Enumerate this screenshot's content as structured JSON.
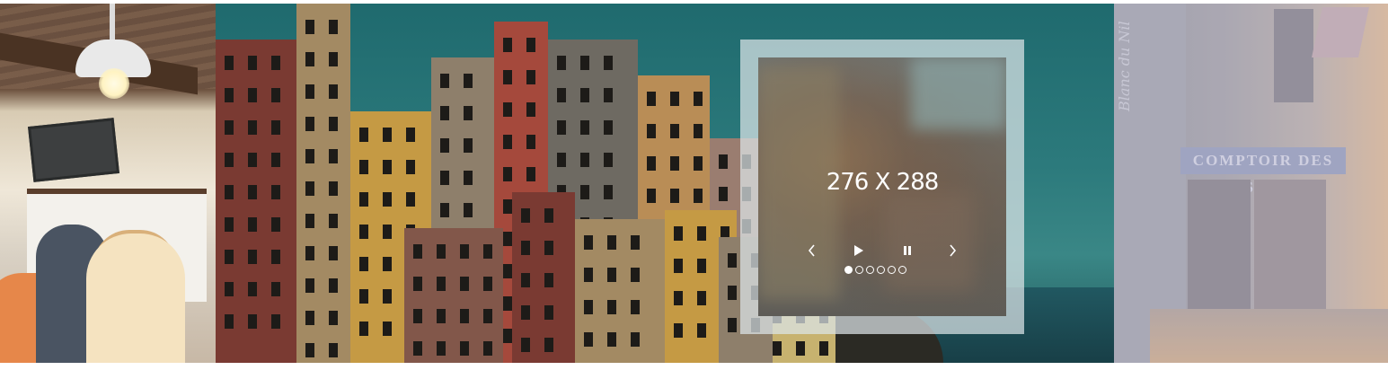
{
  "slider": {
    "slides": [
      {
        "name": "cafe-interior"
      },
      {
        "name": "cliffside-houses"
      },
      {
        "name": "storefront"
      }
    ],
    "right_slide": {
      "sign_text": "COMPTOIR DES ISLES",
      "script_text": "Blanc du Nil"
    }
  },
  "overlay": {
    "dimension_label": "276 X 288",
    "controls": {
      "prev_icon": "chevron-left-icon",
      "play_icon": "play-icon",
      "pause_icon": "pause-icon",
      "next_icon": "chevron-right-icon"
    },
    "pagination": {
      "count": 6,
      "active_index": 0
    }
  },
  "colors": {
    "overlay_frame": "#dce4e8",
    "control_color": "#ffffff",
    "sea": "#215861"
  }
}
